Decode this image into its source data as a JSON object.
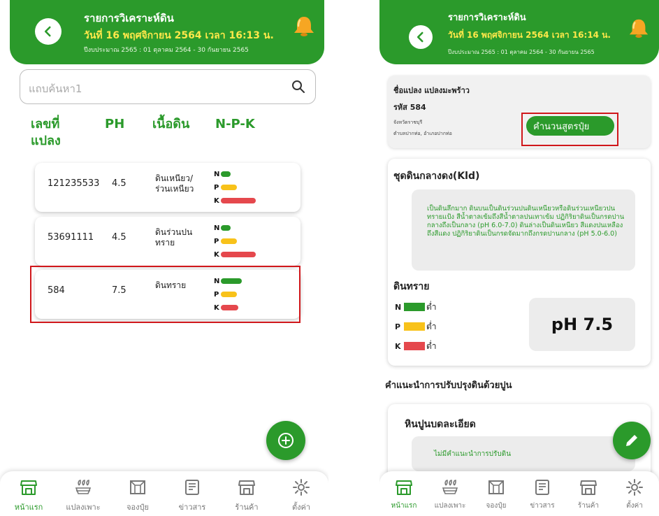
{
  "colors": {
    "primary_green": "#2b9a2b",
    "date_yellow": "#ffe84a",
    "n_green": "#2b9a2b",
    "p_yellow": "#f8c21a",
    "k_red": "#e5484d",
    "highlight_red": "#d0171b"
  },
  "left_screen": {
    "header": {
      "title": "รายการวิเคราะห์ดิน",
      "date": "วันที่ 16 พฤศจิกายน 2564 เวลา 16:13 น.",
      "fiscal": "ปีงบประมาณ 2565 : 01 ตุลาคม 2564 - 30 กันยายน 2565"
    },
    "search": {
      "placeholder": "แถบค้นหา1"
    },
    "columns": {
      "plot_no": "เลขที่\nแปลง",
      "ph": "PH",
      "soil": "เนื้อดิน",
      "npk": "N-P-K"
    },
    "rows": [
      {
        "id": "121235533",
        "ph": "4.5",
        "soil": "ดินเหนียว/\nร่วนเหนียว",
        "n": 0.28,
        "p": 0.45,
        "k": 1.0
      },
      {
        "id": "53691111",
        "ph": "4.5",
        "soil": "ดินร่วนปน\nทราย",
        "n": 0.28,
        "p": 0.45,
        "k": 1.0
      },
      {
        "id": "584",
        "ph": "7.5",
        "soil": "ดินทราย",
        "n": 0.6,
        "p": 0.45,
        "k": 0.5
      }
    ],
    "npk_letters": [
      "N",
      "P",
      "K"
    ]
  },
  "right_screen": {
    "header": {
      "title": "รายการวิเคราะห์ดิน",
      "date": "วันที่ 16 พฤศจิกายน 2564 เวลา 16:14 น.",
      "fiscal": "ปีงบประมาณ 2565 : 01 ตุลาคม 2564 - 30 กันยายน 2565"
    },
    "plot_info": {
      "name": "ชื่อแปลง แปลงมะพร้าว",
      "code": "รหัส 584",
      "province": "จังหวัดราชบุรี",
      "address": "ตำบลปากท่อ, อำเภอปากท่อ",
      "calc_button": "คำนวนสูตรปุ๋ย"
    },
    "soil_series": {
      "title": "ชุดดินกลางดง(Kld)",
      "description": "เป็นดินลึกมาก ดินบนเป็นดินร่วนปนดินเหนียวหรือดินร่วนเหนียวปนทรายแป้ง สีน้ำตาลเข้มถึงสีน้ำตาลปนเทาเข้ม ปฏิกิริยาดินเป็นกรดปานกลางถึงเป็นกลาง (pH 6.0-7.0) ดินล่างเป็นดินเหนียว สีแดงปนเหลืองถึงสีแดง ปฏิกิริยาดินเป็นกรดจัดมากถึงกรดปานกลาง (pH 5.0-6.0)",
      "soil_name": "ดินทราย",
      "npk": [
        {
          "letter": "N",
          "level": "ต่ำ",
          "color": "#2b9a2b"
        },
        {
          "letter": "P",
          "level": "ต่ำ",
          "color": "#f8c21a"
        },
        {
          "letter": "K",
          "level": "ต่ำ",
          "color": "#e5484d"
        }
      ],
      "ph_label": "pH 7.5"
    },
    "lime_heading": "คำแนะนำการปรับปรุงดินด้วยปูน",
    "lime_card": {
      "title": "หินปูนบดละเอียด",
      "text": "ไม่มีคำแนะนำการปรับดิน"
    }
  },
  "bottom_nav": [
    {
      "label": "หน้าแรก",
      "icon": "store-icon",
      "active": true
    },
    {
      "label": "แปลงเพาะ",
      "icon": "plant-plot-icon",
      "active": false
    },
    {
      "label": "จองปุ๋ย",
      "icon": "fertilizer-box-icon",
      "active": false
    },
    {
      "label": "ข่าวสาร",
      "icon": "news-icon",
      "active": false
    },
    {
      "label": "ร้านค้า",
      "icon": "shop-icon",
      "active": false
    },
    {
      "label": "ตั้งค่า",
      "icon": "gear-icon",
      "active": false
    }
  ]
}
